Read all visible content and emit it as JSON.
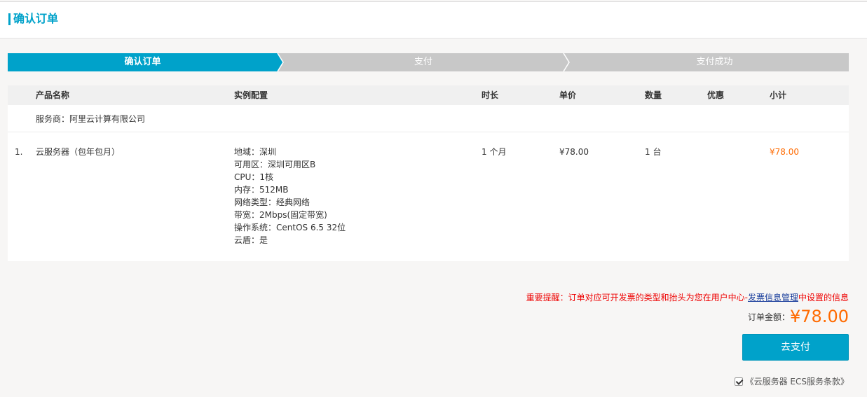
{
  "header": {
    "title": "确认订单"
  },
  "steps": [
    {
      "label": "确认订单",
      "active": true
    },
    {
      "label": "支付",
      "active": false
    },
    {
      "label": "支付成功",
      "active": false
    }
  ],
  "colors": {
    "accent": "#00a2ca",
    "step_inactive": "#c8c8c8",
    "price": "#ff6a00",
    "warning": "#e00000"
  },
  "table": {
    "headers": {
      "product": "产品名称",
      "config": "实例配置",
      "duration": "时长",
      "unit_price": "单价",
      "quantity": "数量",
      "discount": "优惠",
      "subtotal": "小计"
    },
    "vendor": "服务商：阿里云计算有限公司",
    "rows": [
      {
        "index": "1.",
        "product": "云服务器（包年包月）",
        "config": [
          "地域：深圳",
          "可用区：深圳可用区B",
          "CPU：1核",
          "内存：512MB",
          "网络类型：经典网络",
          "带宽：2Mbps(固定带宽)",
          "操作系统：CentOS 6.5 32位",
          "云盾：是"
        ],
        "duration": "1 个月",
        "unit_price": "¥78.00",
        "quantity": "1 台",
        "discount": "",
        "subtotal": "¥78.00"
      }
    ]
  },
  "notice": {
    "prefix": "重要提醒：订单对应可开发票的类型和抬头为您在用户中心-",
    "link": "发票信息管理",
    "suffix": "中设置的信息"
  },
  "total": {
    "label": "订单金额：",
    "amount": "¥78.00"
  },
  "pay_button": "去支付",
  "terms": {
    "checked": true,
    "label": "《云服务器 ECS服务条款》"
  }
}
